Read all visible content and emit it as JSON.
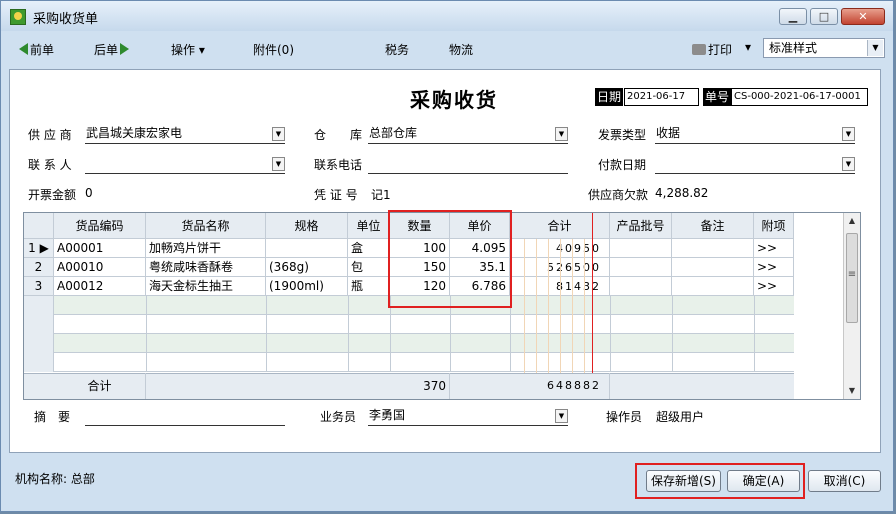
{
  "window": {
    "title": "采购收货单",
    "controls": {
      "minimize": "▁",
      "maximize": "□",
      "close": "✕"
    }
  },
  "toolbar": {
    "prev": "前单",
    "next": "后单",
    "operate": "操作",
    "attachment": "附件(0)",
    "tax": "税务",
    "logistics": "物流",
    "print": "打印",
    "style_value": "标准样式"
  },
  "header": {
    "title": "采购收货",
    "date_label": "日期",
    "date_value": "2021-06-17",
    "no_label": "单号",
    "no_value": "CS-000-2021-06-17-0001"
  },
  "fields": {
    "supplier_label": "供 应 商",
    "supplier_value": "武昌城关康宏家电",
    "warehouse_label": "仓　　库",
    "warehouse_value": "总部仓库",
    "invoice_type_label": "发票类型",
    "invoice_type_value": "收据",
    "contact_label": "联 系 人",
    "contact_value": "",
    "phone_label": "联系电话",
    "phone_value": "",
    "pay_date_label": "付款日期",
    "pay_date_value": "",
    "invoice_amount_label": "开票金额",
    "invoice_amount_value": "0",
    "voucher_label": "凭 证 号",
    "voucher_value": "记1",
    "supplier_debt_label": "供应商欠款",
    "supplier_debt_value": "4,288.82"
  },
  "table": {
    "columns": [
      "货品编码",
      "货品名称",
      "规格",
      "单位",
      "数量",
      "单价",
      "合计",
      "产品批号",
      "备注",
      "附项"
    ],
    "rows": [
      {
        "num": "1",
        "code": "A00001",
        "name": "加畅鸡片饼干",
        "spec": "",
        "unit": "盒",
        "qty": "100",
        "price": "4.095",
        "total": "40950",
        "extra": ">>"
      },
      {
        "num": "2",
        "code": "A00010",
        "name": "粤统咸味香酥卷",
        "spec": "(368g)",
        "unit": "包",
        "qty": "150",
        "price": "35.1",
        "total": "526500",
        "extra": ">>"
      },
      {
        "num": "3",
        "code": "A00012",
        "name": "海天金标生抽王",
        "spec": "(1900ml)",
        "unit": "瓶",
        "qty": "120",
        "price": "6.786",
        "total": "81432",
        "extra": ">>"
      }
    ],
    "footer": {
      "label": "合计",
      "qty": "370",
      "total": "648882"
    }
  },
  "bottom": {
    "summary_label": "摘　要",
    "summary_value": "",
    "salesman_label": "业务员",
    "salesman_value": "李勇国",
    "operator_label": "操作员",
    "operator_value": "超级用户"
  },
  "status": {
    "org": "机构名称: 总部"
  },
  "buttons": {
    "save_new": "保存新增(S)",
    "ok": "确定(A)",
    "cancel": "取消(C)"
  },
  "colors": {
    "window_bg": "#cfe0f0",
    "highlight": "#e02020",
    "arrow": "#2e8a2e"
  }
}
